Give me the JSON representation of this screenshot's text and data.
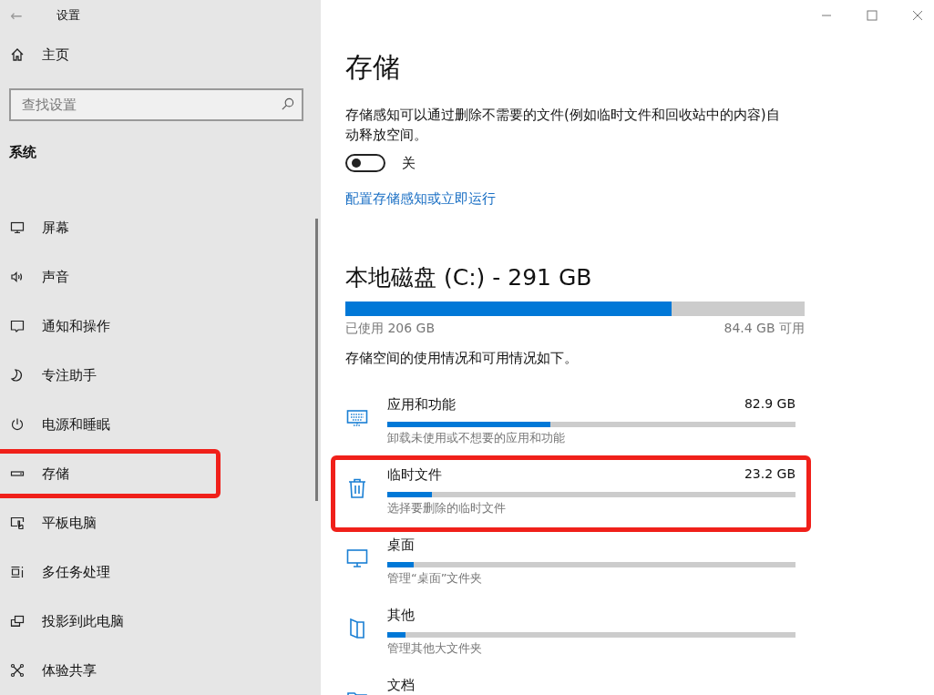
{
  "window": {
    "title": "设置",
    "back": "←"
  },
  "sidebar": {
    "home": "主页",
    "search": {
      "placeholder": "查找设置"
    },
    "section": "系统",
    "items": [
      {
        "kind": "display",
        "label": "屏幕",
        "highlighted": false
      },
      {
        "kind": "sound",
        "label": "声音",
        "highlighted": false
      },
      {
        "kind": "notify",
        "label": "通知和操作",
        "highlighted": false
      },
      {
        "kind": "focus",
        "label": "专注助手",
        "highlighted": false
      },
      {
        "kind": "power",
        "label": "电源和睡眠",
        "highlighted": false
      },
      {
        "kind": "storage",
        "label": "存储",
        "highlighted": true
      },
      {
        "kind": "tablet",
        "label": "平板电脑",
        "highlighted": false
      },
      {
        "kind": "multitask",
        "label": "多任务处理",
        "highlighted": false
      },
      {
        "kind": "project",
        "label": "投影到此电脑",
        "highlighted": false
      },
      {
        "kind": "share",
        "label": "体验共享",
        "highlighted": false
      }
    ]
  },
  "content": {
    "title": "存储",
    "description": "存储感知可以通过删除不需要的文件(例如临时文件和回收站中的内容)自动释放空间。",
    "storage_sense": {
      "on": false,
      "label": "关"
    },
    "link": "配置存储感知或立即运行",
    "disk": {
      "title": "本地磁盘 (C:) - 291 GB",
      "level": 0.71,
      "used": "已使用 206 GB",
      "free": "84.4 GB 可用"
    },
    "usage_note": "存储空间的使用情况和可用情况如下。",
    "categories": [
      {
        "kind": "apps",
        "name": "应用和功能",
        "size": "82.9 GB",
        "level": 0.4,
        "hint": "卸载未使用或不想要的应用和功能",
        "highlighted": false
      },
      {
        "kind": "temp",
        "name": "临时文件",
        "size": "23.2 GB",
        "level": 0.11,
        "hint": "选择要删除的临时文件",
        "highlighted": true
      },
      {
        "kind": "desktop",
        "name": "桌面",
        "level": 0.065,
        "hint": "管理“桌面”文件夹",
        "highlighted": false
      },
      {
        "kind": "other",
        "name": "其他",
        "level": 0.045,
        "hint": "管理其他大文件夹",
        "highlighted": false
      },
      {
        "kind": "docs",
        "name": "文档",
        "highlighted": false
      }
    ]
  }
}
